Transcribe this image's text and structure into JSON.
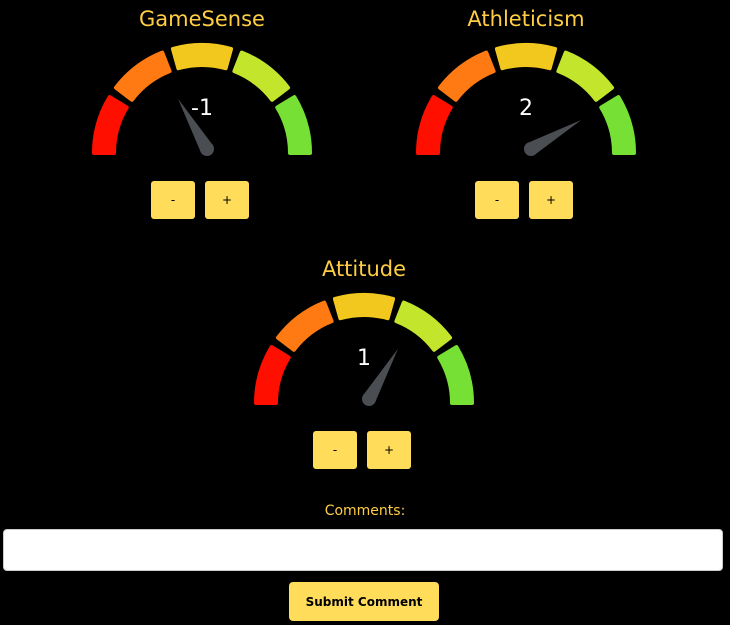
{
  "colors": {
    "background": "#000000",
    "title": "#ffce44",
    "button": "#ffdc5a",
    "needle": "#4a4d52",
    "segments": [
      "#ff0f00",
      "#ff7a12",
      "#f2c81e",
      "#c3e62d",
      "#76e134"
    ]
  },
  "gauges": [
    {
      "title": "GameSense",
      "value": -1,
      "minus_label": "-",
      "plus_label": "+"
    },
    {
      "title": "Athleticism",
      "value": 2,
      "minus_label": "-",
      "plus_label": "+"
    },
    {
      "title": "Attitude",
      "value": 1,
      "minus_label": "-",
      "plus_label": "+"
    }
  ],
  "scale": {
    "min": -3,
    "max": 3
  },
  "comments": {
    "label": "Comments:",
    "value": "",
    "placeholder": "",
    "submit_label": "Submit Comment"
  }
}
